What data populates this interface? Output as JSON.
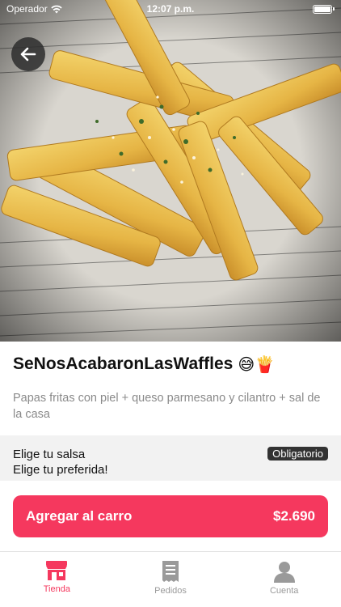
{
  "status_bar": {
    "carrier": "Operador",
    "time": "12:07 p.m."
  },
  "product": {
    "title": "SeNosAcabaronLasWaffles",
    "title_emojis": "😅🍟",
    "description": "Papas fritas con piel + queso parmesano y cilantro + sal de la casa"
  },
  "option_group": {
    "title": "Elige tu salsa",
    "subtitle": "Elige tu preferida!",
    "badge": "Obligatorio"
  },
  "cart_button": {
    "label": "Agregar al carro",
    "price": "$2.690"
  },
  "tabs": [
    {
      "label": "Tienda",
      "icon": "store-icon",
      "active": true
    },
    {
      "label": "Pedidos",
      "icon": "receipt-icon",
      "active": false
    },
    {
      "label": "Cuenta",
      "icon": "user-icon",
      "active": false
    }
  ],
  "colors": {
    "accent": "#f5385e",
    "badge_bg": "#333333",
    "section_bg": "#f2f2f2"
  }
}
